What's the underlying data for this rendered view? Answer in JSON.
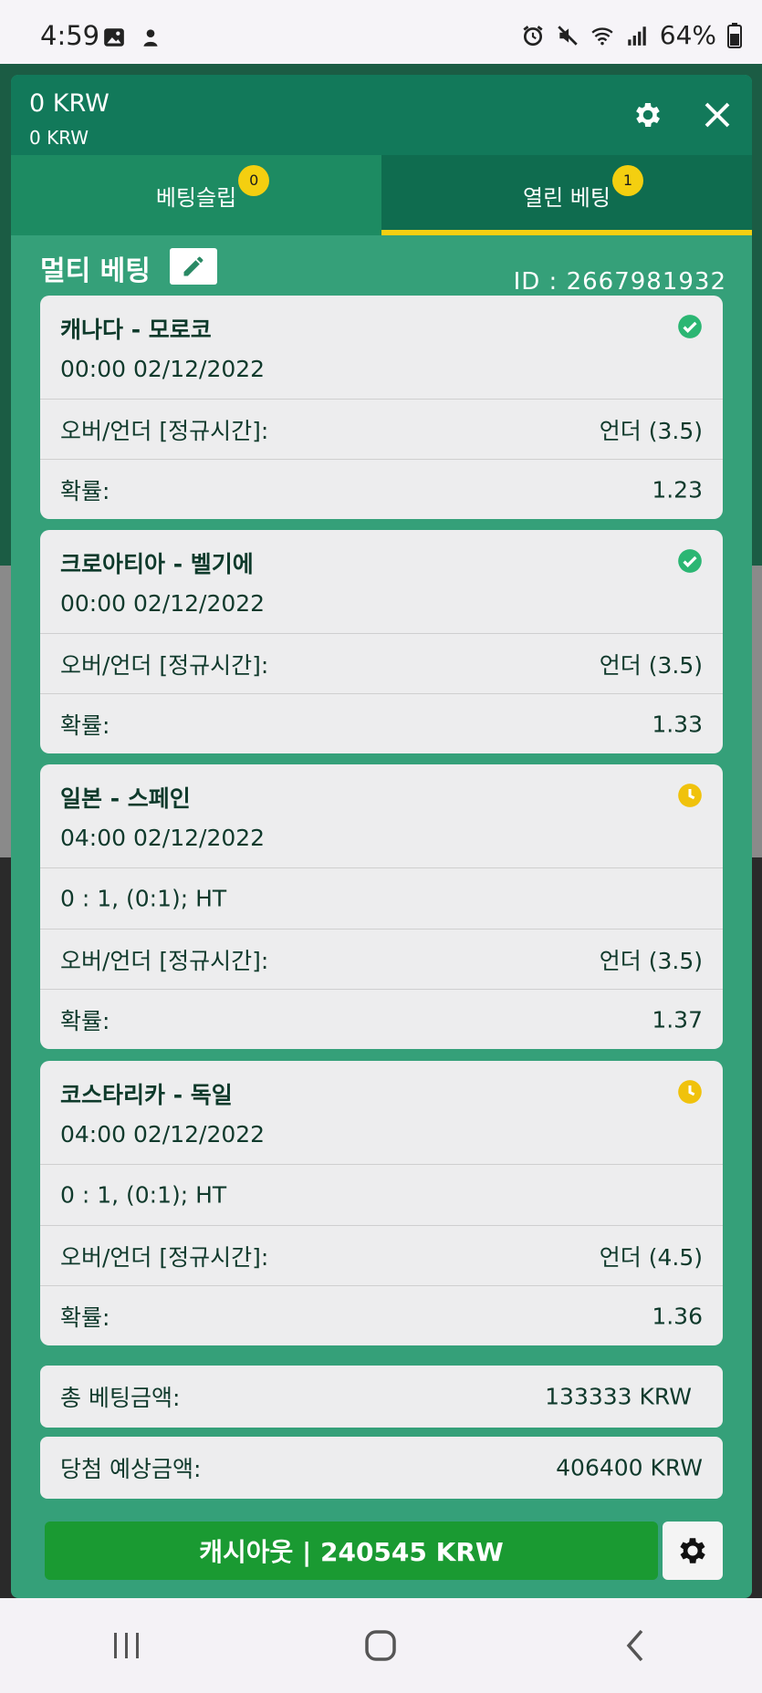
{
  "status_bar": {
    "time": "4:59",
    "battery": "64%"
  },
  "header": {
    "balance": "0 KRW",
    "sub_balance": "0 KRW"
  },
  "tabs": [
    {
      "label": "베팅슬립",
      "badge": "0"
    },
    {
      "label": "열린 베팅",
      "badge": "1"
    }
  ],
  "multi_bet": {
    "title": "멀티 베팅",
    "id_text": "ID :  2667981932"
  },
  "bets": [
    {
      "match": "캐나다 - 모로코",
      "time": "00:00   02/12/2022",
      "status": "won",
      "market": "오버/언더 [정규시간]:",
      "selection": "언더 (3.5)",
      "odds_label": "확률:",
      "odds": "1.23"
    },
    {
      "match": "크로아티아 - 벨기에",
      "time": "00:00   02/12/2022",
      "status": "won",
      "market": "오버/언더 [정규시간]:",
      "selection": "언더 (3.5)",
      "odds_label": "확률:",
      "odds": "1.33"
    },
    {
      "match": "일본 - 스페인",
      "time": "04:00   02/12/2022",
      "status": "pending",
      "score": "0 : 1, (0:1); HT",
      "market": "오버/언더 [정규시간]:",
      "selection": "언더 (3.5)",
      "odds_label": "확률:",
      "odds": "1.37"
    },
    {
      "match": "코스타리카 - 독일",
      "time": "04:00   02/12/2022",
      "status": "pending",
      "score": "0 : 1, (0:1); HT",
      "market": "오버/언더 [정규시간]:",
      "selection": "언더 (4.5)",
      "odds_label": "확률:",
      "odds": "1.36"
    }
  ],
  "summary": {
    "total_label": "총 베팅금액:",
    "total_value": "133333 KRW",
    "expected_label": "당첨 예상금액:",
    "expected_value": "406400 KRW"
  },
  "cashout": {
    "label": "캐시아웃 | 240545 KRW"
  },
  "colors": {
    "panel": "#35a079",
    "header": "#12795a",
    "accent": "#f5cf12",
    "won": "#2bb673",
    "pending": "#f0c20c",
    "cashout": "#1a9a32"
  }
}
